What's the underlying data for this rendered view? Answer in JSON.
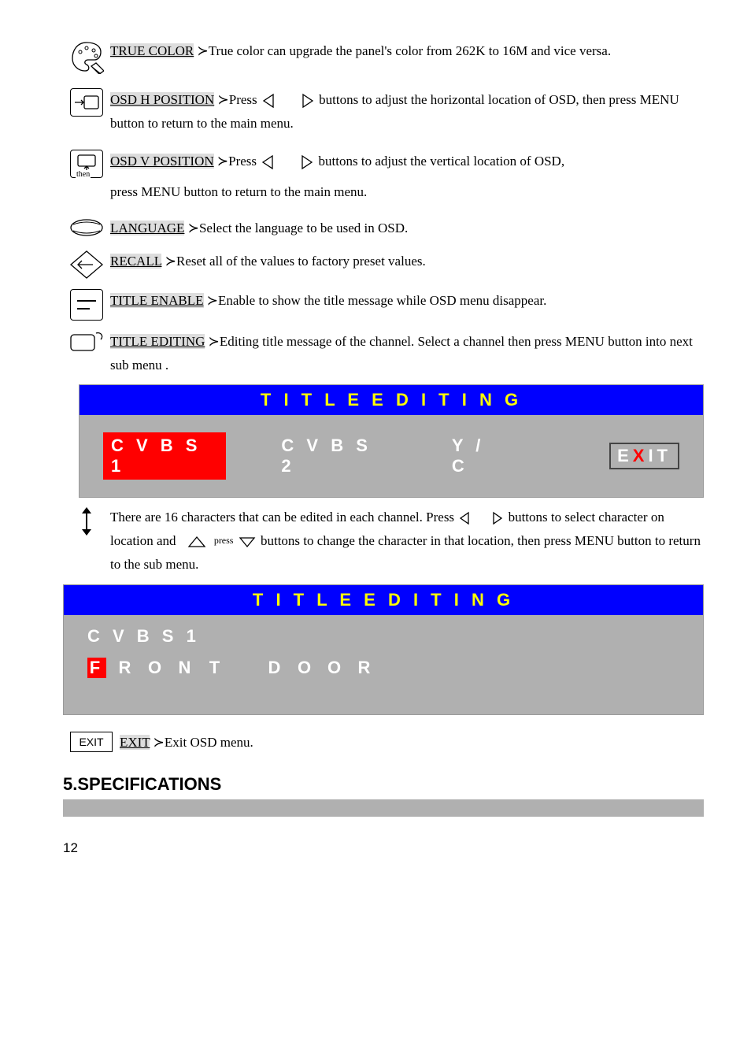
{
  "items": {
    "truecolor": {
      "label": "TRUE COLOR",
      "desc": "True color can upgrade the panel's color from 262K to 16M and vice versa."
    },
    "osdh": {
      "label": "OSD H POSITION",
      "desc1": "Press",
      "desc2": "buttons to adjust the horizontal location of OSD, then press MENU button to return to the main menu."
    },
    "osdv": {
      "label": "OSD V POSITION",
      "desc1": "Press",
      "desc2": "buttons to adjust the vertical location of OSD,",
      "desc3": "press MENU button to return to the main menu.",
      "then": "then"
    },
    "language": {
      "label": "LANGUAGE",
      "desc": "Select the language to be used in OSD."
    },
    "recall": {
      "label": "RECALL",
      "desc": "Reset all of the values to factory preset values."
    },
    "titleenable": {
      "label": "TITLE ENABLE",
      "desc": "Enable to show the title message while OSD menu disappear."
    },
    "titleediting": {
      "label": "TITLE EDITING",
      "desc": "Editing title message of the channel. Select a channel then press MENU button into next sub menu"
    }
  },
  "osd_header": "T I T L E    E D I T I N G",
  "osd_opts": {
    "cvbs1": "C V B S 1",
    "cvbs2": "C V B S 2",
    "yc": "Y / C"
  },
  "exit_e": "E",
  "exit_x": "X",
  "exit_it": "IT",
  "note": {
    "p1": "There are 16 characters that can be edited in each channel. Press",
    "p2": "buttons to select character on location and",
    "press_word": "press",
    "p3": "buttons to change the character in that location, then press MENU button to return to the sub menu."
  },
  "osd2_line1": "C V B S 1",
  "osd2_chars": [
    "F",
    "R",
    "O",
    "N",
    "T",
    "",
    "D",
    "O",
    "O",
    "R",
    "",
    "",
    "",
    "",
    "",
    ""
  ],
  "exitbtn": "EXIT",
  "exititem": {
    "label": "EXIT",
    "desc": "Exit OSD menu."
  },
  "spec_heading": "5.SPECIFICATIONS",
  "pagenum": "12",
  "arrow": "≻"
}
